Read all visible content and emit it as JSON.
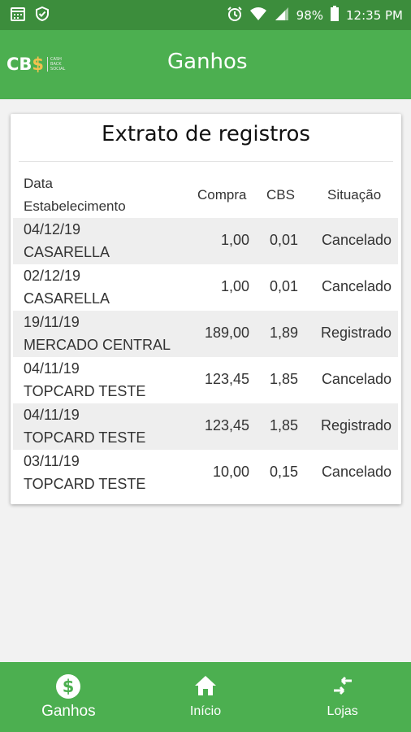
{
  "status_bar": {
    "battery": "98%",
    "time": "12:35 PM",
    "icons": [
      "calendar-icon",
      "shield-icon",
      "alarm-icon",
      "wifi-icon",
      "signal-icon",
      "battery-icon"
    ]
  },
  "app_bar": {
    "logo_text": "CB",
    "logo_symbol": "$",
    "logo_subtext": [
      "CASH",
      "BACK",
      "SOCIAL"
    ],
    "title": "Ganhos"
  },
  "card": {
    "title": "Extrato de registros",
    "headers": {
      "date": "Data",
      "store": "Estabelecimento",
      "compra": "Compra",
      "cbs": "CBS",
      "situacao": "Situação"
    },
    "rows": [
      {
        "date": "04/12/19",
        "store": "CASARELLA",
        "compra": "1,00",
        "cbs": "0,01",
        "situacao": "Cancelado"
      },
      {
        "date": "02/12/19",
        "store": "CASARELLA",
        "compra": "1,00",
        "cbs": "0,01",
        "situacao": "Cancelado"
      },
      {
        "date": "19/11/19",
        "store": "MERCADO CENTRAL",
        "compra": "189,00",
        "cbs": "1,89",
        "situacao": "Registrado"
      },
      {
        "date": "04/11/19",
        "store": "TOPCARD TESTE",
        "compra": "123,45",
        "cbs": "1,85",
        "situacao": "Cancelado"
      },
      {
        "date": "04/11/19",
        "store": "TOPCARD TESTE",
        "compra": "123,45",
        "cbs": "1,85",
        "situacao": "Registrado"
      },
      {
        "date": "03/11/19",
        "store": "TOPCARD TESTE",
        "compra": "10,00",
        "cbs": "0,15",
        "situacao": "Cancelado"
      }
    ]
  },
  "bottom_nav": [
    {
      "label": "Ganhos",
      "icon": "dollar-icon",
      "active": true
    },
    {
      "label": "Início",
      "icon": "home-icon",
      "active": false
    },
    {
      "label": "Lojas",
      "icon": "swap-arrows-icon",
      "active": false
    }
  ],
  "colors": {
    "status_bar": "#3c8d3c",
    "primary": "#4caf50",
    "accent": "#f2c14e",
    "row_alt": "#eeeeee"
  }
}
